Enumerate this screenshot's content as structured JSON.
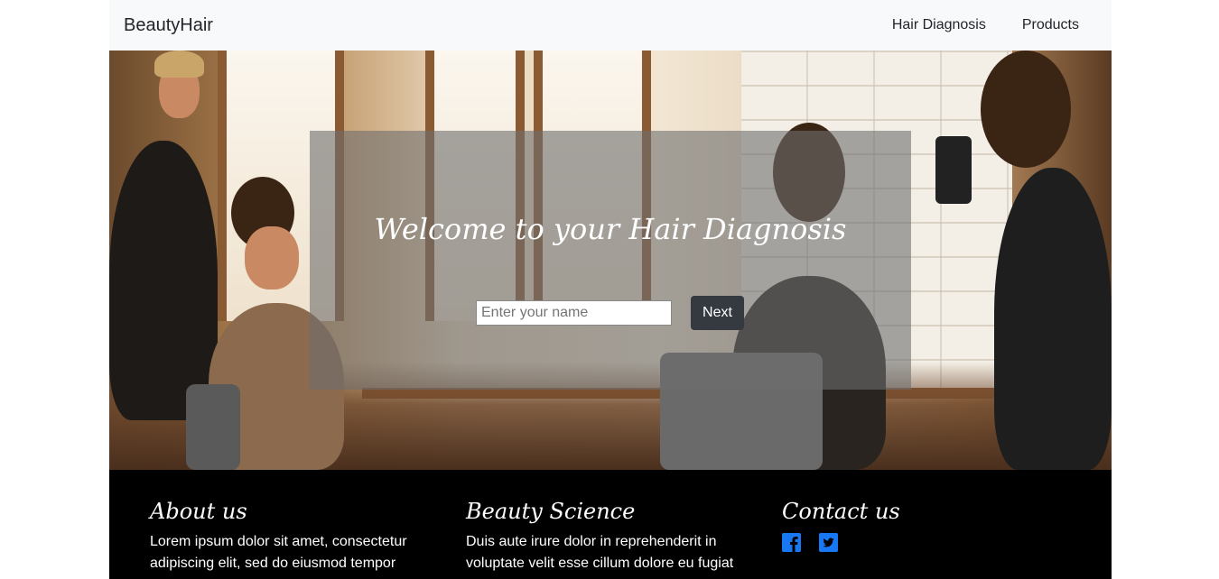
{
  "navbar": {
    "brand": "BeautyHair",
    "links": [
      "Hair Diagnosis",
      "Products"
    ]
  },
  "hero": {
    "title": "Welcome to your Hair Diagnosis",
    "input_placeholder": "Enter your name",
    "input_value": "",
    "next_label": "Next"
  },
  "footer": {
    "about": {
      "heading": "About us",
      "text": "Lorem ipsum dolor sit amet, consectetur adipiscing elit, sed do eiusmod tempor"
    },
    "science": {
      "heading": "Beauty Science",
      "text": "Duis aute irure dolor in reprehenderit in voluptate velit esse cillum dolore eu fugiat"
    },
    "contact": {
      "heading": "Contact us",
      "icons": [
        "facebook-icon",
        "twitter-icon"
      ]
    }
  },
  "colors": {
    "navbar_bg": "#f8f9fa",
    "button_bg": "#343a40",
    "footer_bg": "#000000",
    "social_blue": "#1877f2"
  }
}
